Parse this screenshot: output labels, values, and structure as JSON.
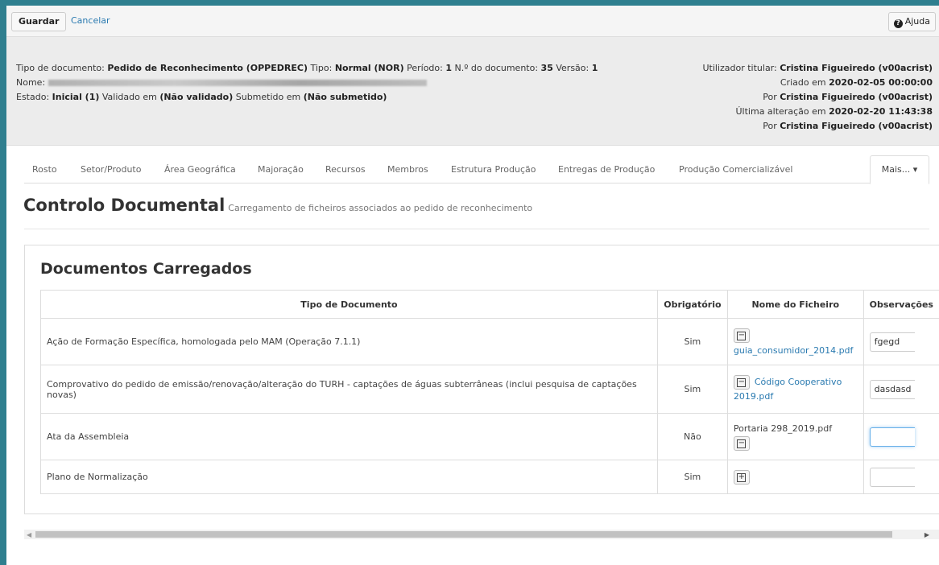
{
  "toolbar": {
    "save": "Guardar",
    "cancel": "Cancelar",
    "help": "Ajuda"
  },
  "info": {
    "l1_a": "Tipo de documento: ",
    "l1_b": "Pedido de Reconhecimento (OPPEDREC)",
    "l1_c": " Tipo: ",
    "l1_d": "Normal (NOR)",
    "l1_e": " Período: ",
    "l1_f": "1",
    "l1_g": " N.º do documento: ",
    "l1_h": "35",
    "l1_i": " Versão: ",
    "l1_j": "1",
    "l2_a": "Nome: ",
    "l3_a": "Estado: ",
    "l3_b": "Inicial (1)",
    "l3_c": " Validado em ",
    "l3_d": "(Não validado)",
    "l3_e": " Submetido em ",
    "l3_f": "(Não submetido)",
    "r1_a": "Utilizador titular: ",
    "r1_b": "Cristina Figueiredo (v00acrist)",
    "r2_a": "Criado em ",
    "r2_b": "2020-02-05 00:00:00",
    "r3_a": "Por ",
    "r3_b": "Cristina Figueiredo (v00acrist)",
    "r4_a": "Última alteração em ",
    "r4_b": "2020-02-20 11:43:38",
    "r5_a": "Por ",
    "r5_b": "Cristina Figueiredo (v00acrist)"
  },
  "tabs": [
    "Rosto",
    "Setor/Produto",
    "Área Geográfica",
    "Majoração",
    "Recursos",
    "Membros",
    "Estrutura Produção",
    "Entregas de Produção",
    "Produção Comercializável"
  ],
  "tab_more": "Mais... ▾",
  "heading": {
    "title": "Controlo Documental",
    "subtitle": "Carregamento de ficheiros associados ao pedido de reconhecimento"
  },
  "panel": {
    "title": "Documentos Carregados",
    "headers": [
      "Tipo de Documento",
      "Obrigatório",
      "Nome do Ficheiro",
      "Observações"
    ],
    "rows": [
      {
        "tipo": "Ação de Formação Específica, homologada pelo MAM (Operação 7.1.1)",
        "obrig": "Sim",
        "file": "guia_consumidor_2014.pdf",
        "obs": "fgegd"
      },
      {
        "tipo": "Comprovativo do pedido de emissão/renovação/alteração do TURH - captações de águas subterrâneas (inclui pesquisa de captações novas)",
        "obrig": "Sim",
        "file": "Código Cooperativo 2019.pdf",
        "obs": "dasdasd"
      },
      {
        "tipo": "Ata da Assembleia",
        "obrig": "Não",
        "file": "Portaria 298_2019.pdf",
        "obs": ""
      },
      {
        "tipo": "Plano de Normalização",
        "obrig": "Sim",
        "file": "",
        "obs": ""
      }
    ]
  },
  "icons": {
    "remove": "minus-square-icon",
    "add": "plus-square-icon",
    "help": "question-circle-icon"
  }
}
